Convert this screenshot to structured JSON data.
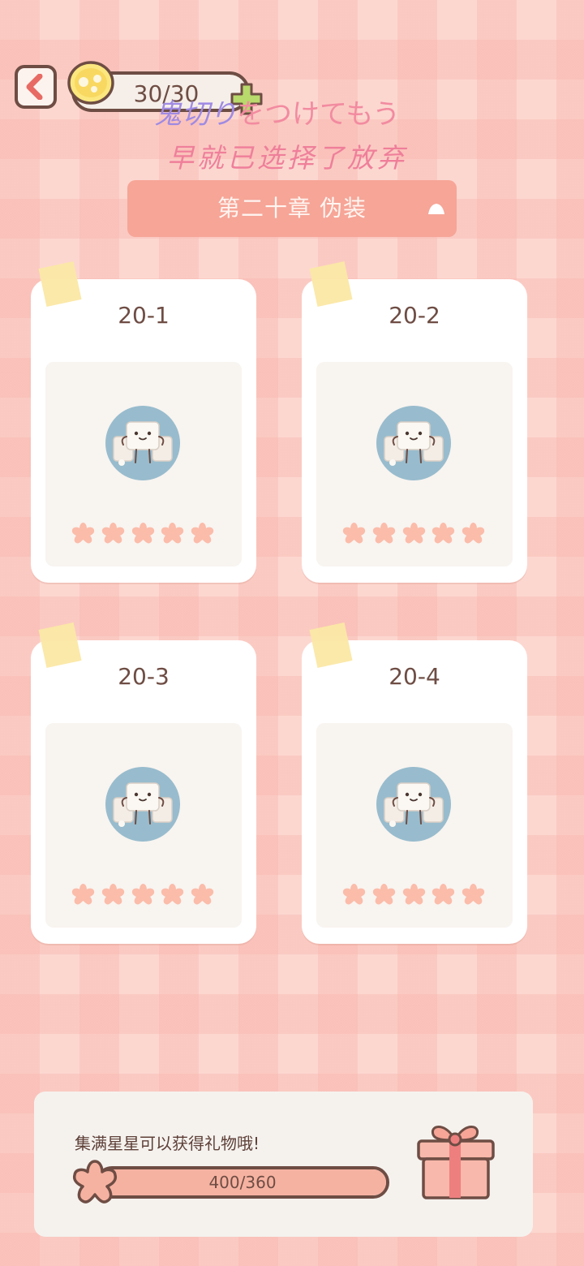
{
  "top_bar": {
    "energy": "30/30"
  },
  "overlay": {
    "jp_part1": "鬼切り",
    "jp_part2": "をつけてもう",
    "cn_line": "早就已选择了放弃"
  },
  "chapter": {
    "label": "第二十章  伪装"
  },
  "levels": [
    {
      "title": "20-1",
      "stars_earned": 5,
      "stars_total": 5
    },
    {
      "title": "20-2",
      "stars_earned": 5,
      "stars_total": 5
    },
    {
      "title": "20-3",
      "stars_earned": 5,
      "stars_total": 5
    },
    {
      "title": "20-4",
      "stars_earned": 5,
      "stars_total": 5
    }
  ],
  "reward": {
    "message": "集满星星可以获得礼物哦!",
    "progress_text": "400/360",
    "progress_fraction": 1.0
  },
  "icons": {
    "back": "chevron-left-icon",
    "energy": "tofu-coin-icon",
    "add": "plus-icon",
    "caret": "caret-up-icon",
    "gift": "gift-icon",
    "star": "flower-star-icon"
  },
  "colors": {
    "background": "#fcd7d0",
    "accent": "#f6a597",
    "outline": "#6e4d44",
    "star": "#fbbcaa",
    "avatar_bg": "#98bccd"
  }
}
